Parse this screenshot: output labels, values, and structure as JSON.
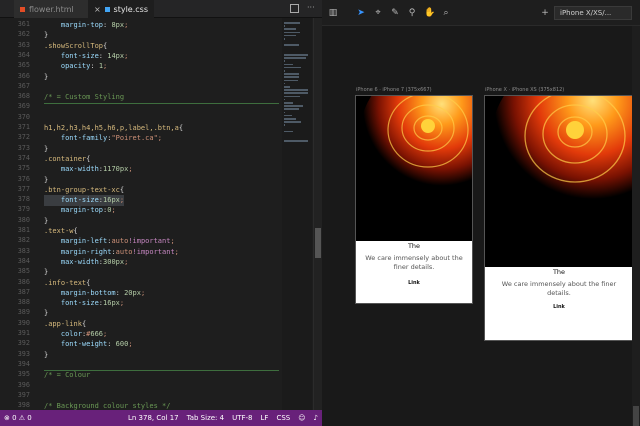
{
  "colors": {
    "status_bar": "#68217a",
    "editor_bg": "#1e1e1e",
    "selector": "#d7ba7d",
    "property": "#9cdcfe",
    "string_value": "#ce9178",
    "comment": "#6a9955",
    "active_tool": "#3794ff"
  },
  "editor": {
    "tabs": [
      {
        "label": "flower.html",
        "active": false,
        "icon": "html-file-icon"
      },
      {
        "label": "style.css",
        "active": true,
        "icon": "css-file-icon"
      }
    ],
    "tab_actions": [
      "split-editor-icon",
      "more-icon"
    ],
    "lines": [
      {
        "n": "361",
        "text": "    margin-top: 8px;"
      },
      {
        "n": "362",
        "text": "}"
      },
      {
        "n": "363",
        "text": ".showScrollTop{"
      },
      {
        "n": "364",
        "text": "    font-size: 14px;"
      },
      {
        "n": "365",
        "text": "    opacity: 1;"
      },
      {
        "n": "366",
        "text": "}"
      },
      {
        "n": "367",
        "text": ""
      },
      {
        "n": "368",
        "text": "/* = Custom Styling"
      },
      {
        "n": "369",
        "text": ""
      },
      {
        "n": "370",
        "text": ""
      },
      {
        "n": "371",
        "text": "h1,h2,h3,h4,h5,h6,p,label,.btn,a{"
      },
      {
        "n": "372",
        "text": "    font-family:\"Poiret.ca\";"
      },
      {
        "n": "373",
        "text": "}"
      },
      {
        "n": "374",
        "text": ".container{"
      },
      {
        "n": "375",
        "text": "    max-width:1170px;"
      },
      {
        "n": "376",
        "text": "}"
      },
      {
        "n": "377",
        "text": ".btn-group-text-xc{"
      },
      {
        "n": "378",
        "text": "    font-size:16px;"
      },
      {
        "n": "379",
        "text": "    margin-top:0;"
      },
      {
        "n": "380",
        "text": "}"
      },
      {
        "n": "381",
        "text": ".text-w{"
      },
      {
        "n": "382",
        "text": "    margin-left:auto!important;"
      },
      {
        "n": "383",
        "text": "    margin-right:auto!important;"
      },
      {
        "n": "384",
        "text": "    max-width:300px;"
      },
      {
        "n": "385",
        "text": "}"
      },
      {
        "n": "386",
        "text": ".info-text{"
      },
      {
        "n": "387",
        "text": "    margin-bottom: 20px;"
      },
      {
        "n": "388",
        "text": "    font-size:16px;"
      },
      {
        "n": "389",
        "text": "}"
      },
      {
        "n": "390",
        "text": ".app-link{"
      },
      {
        "n": "391",
        "text": "    color:#666;"
      },
      {
        "n": "392",
        "text": "    font-weight: 600;"
      },
      {
        "n": "393",
        "text": "}"
      },
      {
        "n": "394",
        "text": ""
      },
      {
        "n": "395",
        "text": "/* = Colour"
      },
      {
        "n": "396",
        "text": ""
      },
      {
        "n": "397",
        "text": ""
      },
      {
        "n": "398",
        "text": "/* Background colour styles */"
      }
    ]
  },
  "status_bar": {
    "errors": "0",
    "warnings": "0",
    "position": "Ln 378, Col 17",
    "tab_size": "Tab Size: 4",
    "encoding": "UTF-8",
    "eol": "LF",
    "language": "CSS"
  },
  "simulator": {
    "tools": [
      "sidebar-toggle-icon",
      "pointer-icon",
      "crosshair-icon",
      "pen-icon",
      "dropper-icon",
      "hand-icon",
      "zoom-icon",
      "add-icon"
    ],
    "device": "iPhone X/XS/...",
    "frames": [
      {
        "caption": "iPhone 6 · iPhone 7 (375x667)",
        "title": "The",
        "text": "We care immensely about the finer details.",
        "link": "Link"
      },
      {
        "caption": "iPhone X · iPhone XS (375x812)",
        "title": "The",
        "text": "We care immensely about the finer details.",
        "link": "Link"
      }
    ]
  }
}
